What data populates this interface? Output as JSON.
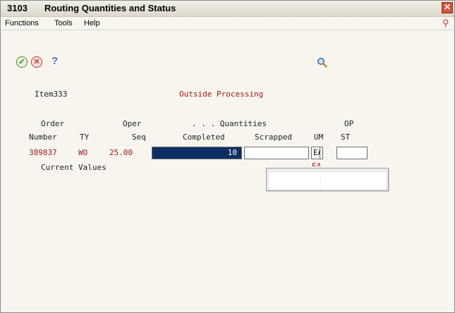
{
  "window": {
    "number": "3103",
    "title": "Routing Quantities and Status",
    "close_glyph": "✕"
  },
  "menu": {
    "functions": "Functions",
    "tools": "Tools",
    "help": "Help"
  },
  "toolbar": {
    "ok_glyph": "✓",
    "cancel_glyph": "✕",
    "help_glyph": "?"
  },
  "header": {
    "item": "Item333",
    "section": "Outside Processing"
  },
  "columns": {
    "order_line1": "Order",
    "order_line2": "Number",
    "ty": "TY",
    "oper_line1": "Oper",
    "oper_line2": "Seq",
    "quantities": ". . . Quantities",
    "completed": "Completed",
    "scrapped": "Scrapped",
    "um": "UM",
    "op_line1": "OP",
    "op_line2": "ST"
  },
  "row": {
    "order_number": "389837",
    "ty": "WO",
    "oper_seq": "25.00",
    "completed": "10",
    "scrapped": "",
    "um": "EA",
    "op_status": ""
  },
  "current_values_label": "Current Values",
  "ghost_um": "EA",
  "icons": {
    "ok": "check-icon",
    "cancel": "cancel-icon",
    "help": "help-icon",
    "search": "search-icon",
    "close": "close-icon",
    "pin": "pin-icon"
  }
}
